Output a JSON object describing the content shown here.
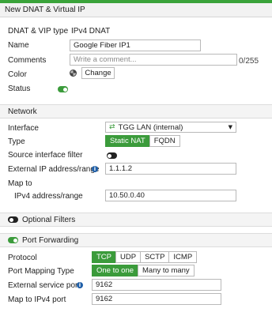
{
  "window": {
    "title": "New DNAT & Virtual IP"
  },
  "general": {
    "type_label": "DNAT & VIP type",
    "type_value": "IPv4 DNAT",
    "name_label": "Name",
    "name_value": "Google Fiber IP1",
    "comments_label": "Comments",
    "comments_placeholder": "Write a comment...",
    "comments_counter": "0/255",
    "color_label": "Color",
    "color_button": "Change",
    "status_label": "Status",
    "status_on": true
  },
  "network": {
    "section_title": "Network",
    "interface_label": "Interface",
    "interface_value": "TGG LAN (internal)",
    "type_label": "Type",
    "type_options": [
      "Static NAT",
      "FQDN"
    ],
    "type_selected": "Static NAT",
    "source_filter_label": "Source interface filter",
    "source_filter_on": false,
    "external_ip_label": "External IP address/range",
    "external_ip_value": "1.1.1.2",
    "map_to_label": "Map to",
    "ipv4_label": "IPv4 address/range",
    "ipv4_value": "10.50.0.40"
  },
  "optional_filters": {
    "section_title": "Optional Filters",
    "enabled": false
  },
  "port_forwarding": {
    "section_title": "Port Forwarding",
    "enabled": true,
    "protocol_label": "Protocol",
    "protocol_options": [
      "TCP",
      "UDP",
      "SCTP",
      "ICMP"
    ],
    "protocol_selected": "TCP",
    "mapping_type_label": "Port Mapping Type",
    "mapping_options": [
      "One to one",
      "Many to many"
    ],
    "mapping_selected": "One to one",
    "external_port_label": "External service port",
    "external_port_value": "9162",
    "map_ipv4_port_label": "Map to IPv4 port",
    "map_ipv4_port_value": "9162"
  },
  "colors": {
    "accent": "#3b9b3b",
    "info": "#1f5fa8"
  }
}
